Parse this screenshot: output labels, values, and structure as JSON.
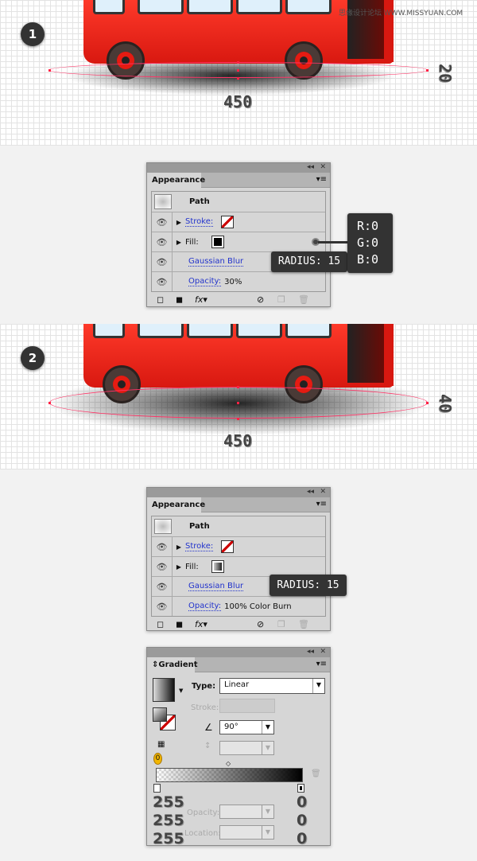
{
  "watermark": "思缘设计论坛 WWW.MISSYUAN.COM",
  "step1": {
    "badge": "1",
    "width_label": "450",
    "height_label": "20"
  },
  "step2": {
    "badge": "2",
    "width_label": "450",
    "height_label": "40"
  },
  "appearance1": {
    "tab": "Appearance",
    "title": "Path",
    "stroke": "Stroke:",
    "fill": "Fill:",
    "effect": "Gaussian Blur",
    "opacity_label": "Opacity:",
    "opacity_value": "30%",
    "fill_color": "#000000",
    "tooltip_radius": "RADIUS: 15",
    "tooltip_rgb": [
      "R:0",
      "G:0",
      "B:0"
    ]
  },
  "appearance2": {
    "tab": "Appearance",
    "title": "Path",
    "stroke": "Stroke:",
    "fill": "Fill:",
    "effect": "Gaussian Blur",
    "opacity_label": "Opacity:",
    "opacity_value": "100% Color Burn",
    "tooltip_radius": "RADIUS: 15"
  },
  "gradient": {
    "tab": "Gradient",
    "type_label": "Type:",
    "type_value": "Linear",
    "stroke_label": "Stroke:",
    "angle_value": "90°",
    "opacity_label": "Opacity:",
    "location_label": "Location:",
    "left_stop": [
      "255",
      "255",
      "255"
    ],
    "right_stop": [
      "0",
      "0",
      "0"
    ]
  },
  "panel_controls": {
    "collapse": "◂◂",
    "close": "✕",
    "menu": "▾≡"
  }
}
